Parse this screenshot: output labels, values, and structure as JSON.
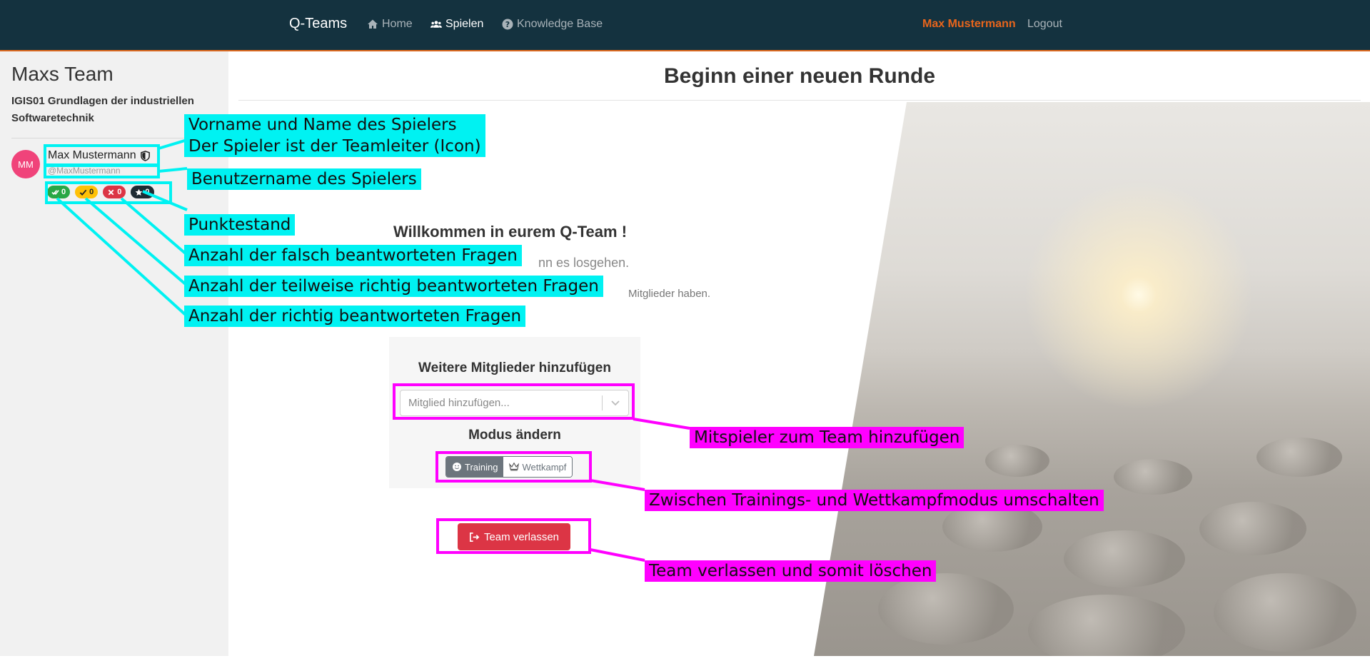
{
  "nav": {
    "brand": "Q-Teams",
    "home": "Home",
    "play": "Spielen",
    "kb": "Knowledge Base",
    "user": "Max Mustermann",
    "logout": "Logout"
  },
  "sidebar": {
    "team_name": "Maxs Team",
    "course": "IGIS01 Grundlagen der industriellen Softwaretechnik",
    "player": {
      "initials": "MM",
      "name": "Max Mustermann",
      "username": "@MaxMustermann",
      "badges": {
        "correct": "0",
        "partial": "0",
        "wrong": "0",
        "score": "0"
      }
    }
  },
  "main": {
    "title": "Beginn einer neuen Runde",
    "welcome": "Willkommen in eurem Q-Team !",
    "subtext": "nn es losgehen.",
    "subtext2": "Mitglieder haben.",
    "add_members_heading": "Weitere Mitglieder hinzufügen",
    "add_member_placeholder": "Mitglied hinzufügen...",
    "mode_heading": "Modus ändern",
    "mode_training": "Training",
    "mode_competition": "Wettkampf",
    "leave_team": "Team verlassen"
  },
  "annotations": {
    "name_line1": "Vorname und Name des Spielers",
    "name_line2": "Der Spieler ist der Teamleiter (Icon)",
    "username": "Benutzername des Spielers",
    "score": "Punktestand",
    "wrong": "Anzahl der falsch beantworteten Fragen",
    "partial": "Anzahl der teilweise richtig beantworteten Fragen",
    "correct": "Anzahl der richtig beantworteten Fragen",
    "add_member": "Mitspieler zum Team hinzufügen",
    "toggle_mode": "Zwischen Trainings- und Wettkampfmodus umschalten",
    "leave": "Team verlassen und somit löschen"
  },
  "colors": {
    "navbar": "#14323f",
    "accent_user": "#e8651c",
    "annotation_cyan": "#00f2f2",
    "annotation_magenta": "#ff00ff",
    "danger": "#dc3545"
  }
}
